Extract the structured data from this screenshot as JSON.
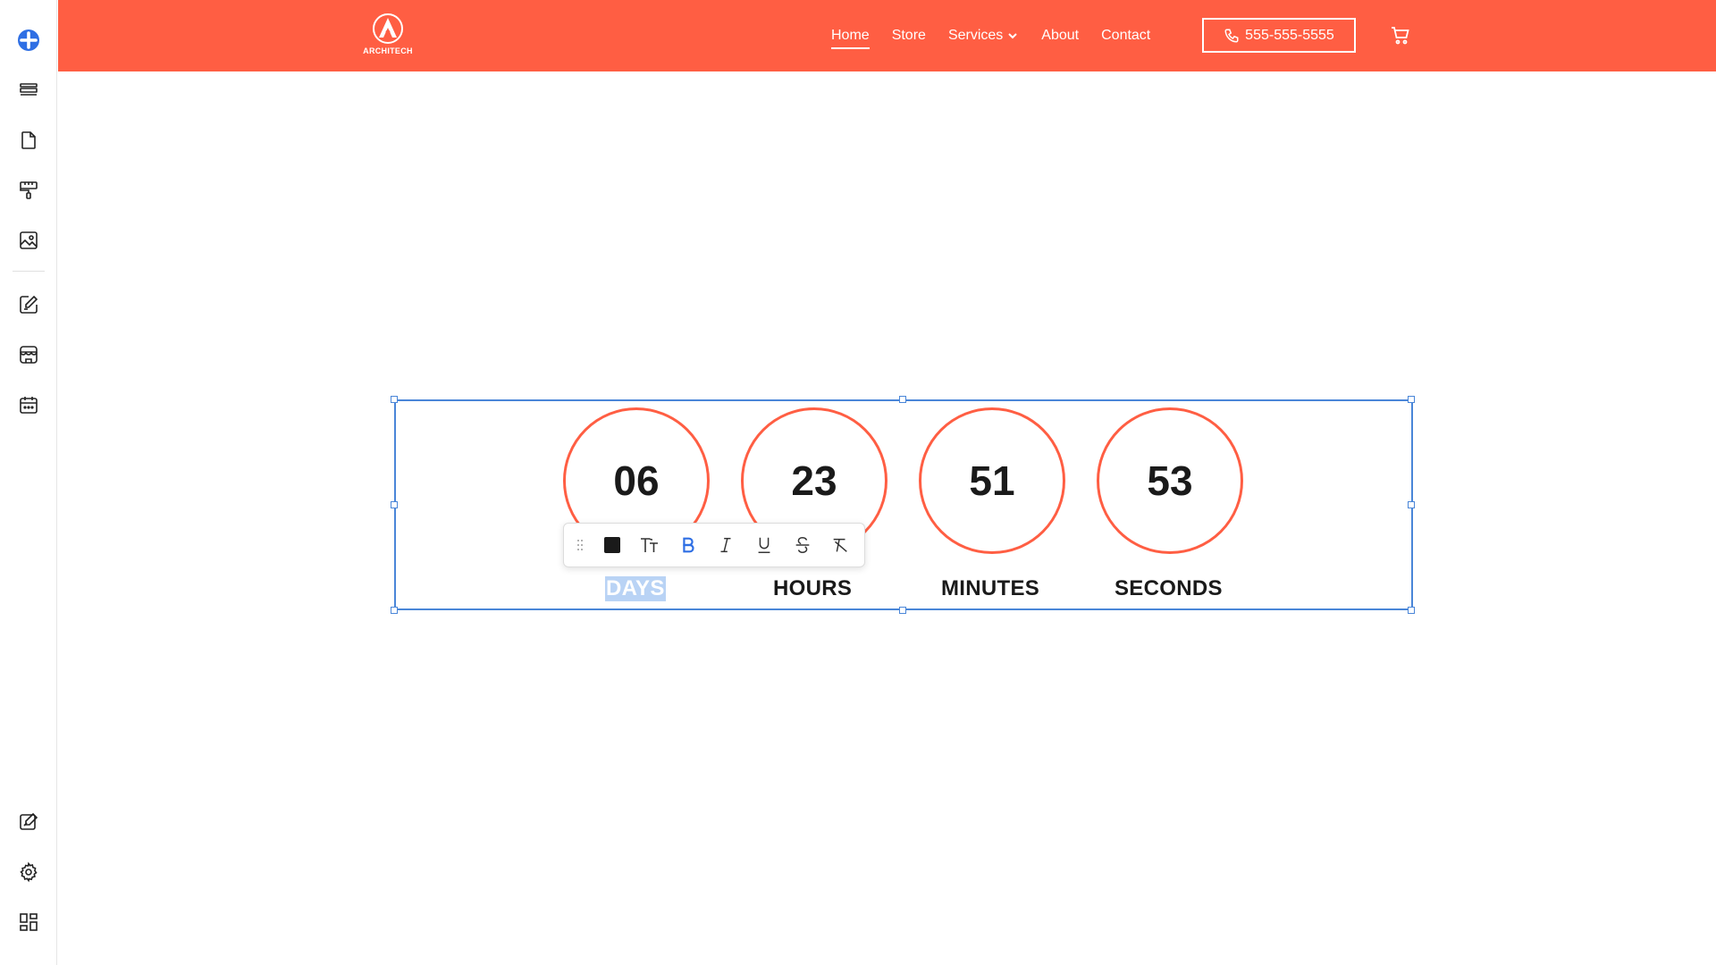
{
  "colors": {
    "brand": "#ff5e43",
    "selection_border": "#4a86d8",
    "accent_blue": "#2f6fe4",
    "text_dark": "#1a1a1a"
  },
  "sidebar": {
    "top_items": [
      {
        "icon": "add-icon"
      },
      {
        "icon": "layers-icon"
      },
      {
        "icon": "page-icon"
      },
      {
        "icon": "paint-roller-icon"
      },
      {
        "icon": "image-icon"
      },
      {
        "icon": "edit-square-icon"
      },
      {
        "icon": "store-icon"
      },
      {
        "icon": "calendar-icon"
      }
    ],
    "bottom_items": [
      {
        "icon": "edit-design-icon"
      },
      {
        "icon": "gear-icon"
      },
      {
        "icon": "dashboard-grid-icon"
      }
    ]
  },
  "header": {
    "logo_text": "ARCHITECH",
    "nav": [
      {
        "label": "Home",
        "active": true
      },
      {
        "label": "Store",
        "active": false
      },
      {
        "label": "Services",
        "active": false,
        "has_dropdown": true
      },
      {
        "label": "About",
        "active": false
      },
      {
        "label": "Contact",
        "active": false
      }
    ],
    "phone": "555-555-5555",
    "cart_icon": "cart-icon"
  },
  "toolbar": {
    "items": [
      "drag-grip-icon",
      "text-color-icon",
      "font-size-icon",
      "bold-icon",
      "italic-icon",
      "underline-icon",
      "strikethrough-icon",
      "clear-format-icon"
    ],
    "bold_active": true
  },
  "countdown": {
    "days": {
      "value": "06",
      "label": "DAYS"
    },
    "hours": {
      "value": "23",
      "label": "HOURS"
    },
    "minutes": {
      "value": "51",
      "label": "MINUTES"
    },
    "seconds": {
      "value": "53",
      "label": "SECONDS"
    },
    "selected_label": "DAYS"
  }
}
